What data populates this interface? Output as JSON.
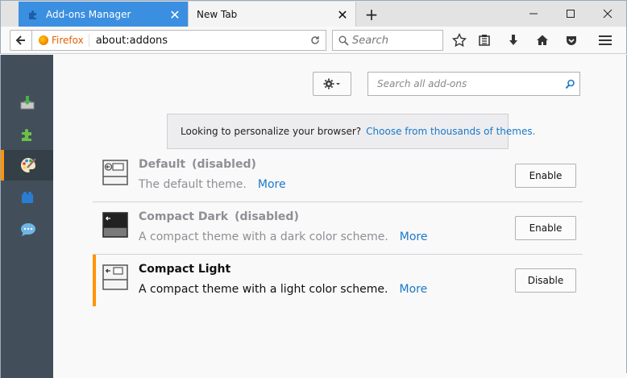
{
  "tabs": [
    {
      "label": "Add-ons Manager",
      "active": true,
      "icon": "puzzle-icon"
    },
    {
      "label": "New Tab",
      "active": false
    }
  ],
  "window_controls": {
    "minimize": "—",
    "maximize": "☐",
    "close": "✕"
  },
  "navbar": {
    "identity_label": "Firefox",
    "url": "about:addons",
    "search_placeholder": "Search"
  },
  "sidebar": {
    "categories": [
      {
        "id": "get-addons",
        "icon": "download-box-icon"
      },
      {
        "id": "extensions",
        "icon": "puzzle-piece-icon"
      },
      {
        "id": "themes",
        "icon": "paint-palette-icon",
        "selected": true
      },
      {
        "id": "plugins",
        "icon": "lego-brick-icon"
      },
      {
        "id": "languages",
        "icon": "speech-bubble-icon"
      }
    ]
  },
  "main": {
    "search_placeholder": "Search all add-ons",
    "notice_text": "Looking to personalize your browser?",
    "notice_link": "Choose from thousands of themes.",
    "addons": [
      {
        "name": "Default",
        "status": "(disabled)",
        "description": "The default theme.",
        "more": "More",
        "action": "Enable",
        "state": "disabled"
      },
      {
        "name": "Compact Dark",
        "status": "(disabled)",
        "description": "A compact theme with a dark color scheme.",
        "more": "More",
        "action": "Enable",
        "state": "disabled"
      },
      {
        "name": "Compact Light",
        "status": "",
        "description": "A compact theme with a light color scheme.",
        "more": "More",
        "action": "Disable",
        "state": "active"
      }
    ]
  },
  "colors": {
    "accent_orange": "#ff9500",
    "tab_active_blue": "#3b8fe0",
    "link_blue": "#1a79c8",
    "sidebar_bg": "#424f5a"
  }
}
